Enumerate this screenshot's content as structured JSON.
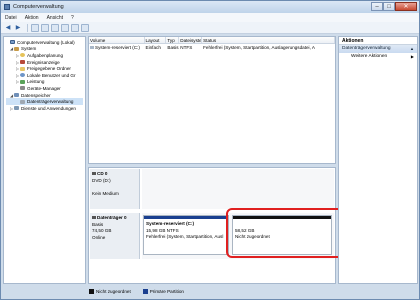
{
  "window": {
    "title": "Computerverwaltung"
  },
  "menu": [
    "Datei",
    "Aktion",
    "Ansicht",
    "?"
  ],
  "tree": [
    {
      "label": "Computerverwaltung (Lokal)",
      "indent": 0,
      "exp": "",
      "icon": "mon",
      "selected": false
    },
    {
      "label": "System",
      "indent": 1,
      "exp": "◢",
      "icon": "sys",
      "selected": false
    },
    {
      "label": "Aufgabenplanung",
      "indent": 2,
      "exp": "▷",
      "icon": "clk",
      "selected": false
    },
    {
      "label": "Ereignisanzeige",
      "indent": 2,
      "exp": "▷",
      "icon": "evt",
      "selected": false
    },
    {
      "label": "Freigegebene Ordner",
      "indent": 2,
      "exp": "▷",
      "icon": "fld",
      "selected": false
    },
    {
      "label": "Lokale Benutzer und Gr",
      "indent": 2,
      "exp": "▷",
      "icon": "usr",
      "selected": false
    },
    {
      "label": "Leistung",
      "indent": 2,
      "exp": "▷",
      "icon": "perf",
      "selected": false
    },
    {
      "label": "Geräte-Manager",
      "indent": 2,
      "exp": "",
      "icon": "dev",
      "selected": false
    },
    {
      "label": "Datenspeicher",
      "indent": 1,
      "exp": "◢",
      "icon": "sto",
      "selected": false
    },
    {
      "label": "Datenträgerverwaltung",
      "indent": 2,
      "exp": "",
      "icon": "dsk",
      "selected": true
    },
    {
      "label": "Dienste und Anwendungen",
      "indent": 1,
      "exp": "▷",
      "icon": "svc",
      "selected": false
    }
  ],
  "volumes": {
    "headers": [
      "Volume",
      "Layout",
      "Typ",
      "Dateisystem",
      "Status"
    ],
    "rows": [
      [
        "System-reserviert (C:)",
        "Einfach",
        "Basis",
        "NTFS",
        "Fehlerfrei (System, Startpartition, Auslagerungsdatei, A"
      ]
    ]
  },
  "disks": [
    {
      "name": "CD 0",
      "lines": [
        "DVD (D:)",
        "",
        "Kein Medium"
      ],
      "partitions": []
    },
    {
      "name": "Datenträger 0",
      "lines": [
        "Basis",
        "74,50 GB",
        "Online"
      ],
      "partitions": [
        {
          "name": "System-reserviert  (C:)",
          "lines": [
            "15,98 GB NTFS",
            "Fehlerfrei (System, Startpartition, Ausl"
          ],
          "color": "#1a3f8f"
        },
        {
          "name": "",
          "lines": [
            "58,52 GB",
            "Nicht zugeordnet"
          ],
          "color": "#111111"
        }
      ]
    }
  ],
  "legend": [
    {
      "label": "Nicht zugeordnet",
      "color": "#111111"
    },
    {
      "label": "Primäre Partition",
      "color": "#1a3f8f"
    }
  ],
  "actions": {
    "title": "Aktionen",
    "section": "Datenträgerverwaltung",
    "link": "Weitere Aktionen"
  },
  "colors": {
    "highlight": "#e02020"
  }
}
